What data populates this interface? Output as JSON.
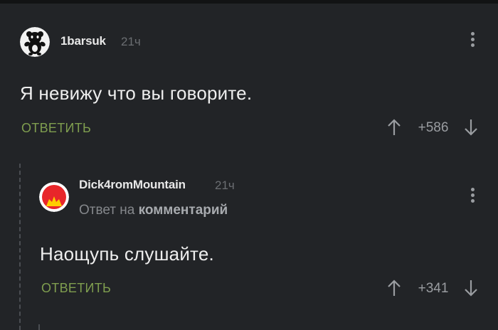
{
  "comments": [
    {
      "username": "1barsuk",
      "time": "21ч",
      "text": "Я невижу что вы говорите.",
      "reply_label": "ОТВЕТИТЬ",
      "rating": "+586"
    },
    {
      "username": "Dick4romMountain",
      "time": "21ч",
      "reply_to_prefix": "Ответ на",
      "reply_to_link": "комментарий",
      "text": "Наощупь слушайте.",
      "reply_label": "ОТВЕТИТЬ",
      "rating": "+341"
    }
  ],
  "icons": {
    "upvote": "arrow-up-icon",
    "downvote": "arrow-down-icon",
    "more": "more-vertical-icon"
  },
  "colors": {
    "background": "#222427",
    "accent_green": "#7f9e4f",
    "muted": "#6b6e72"
  }
}
